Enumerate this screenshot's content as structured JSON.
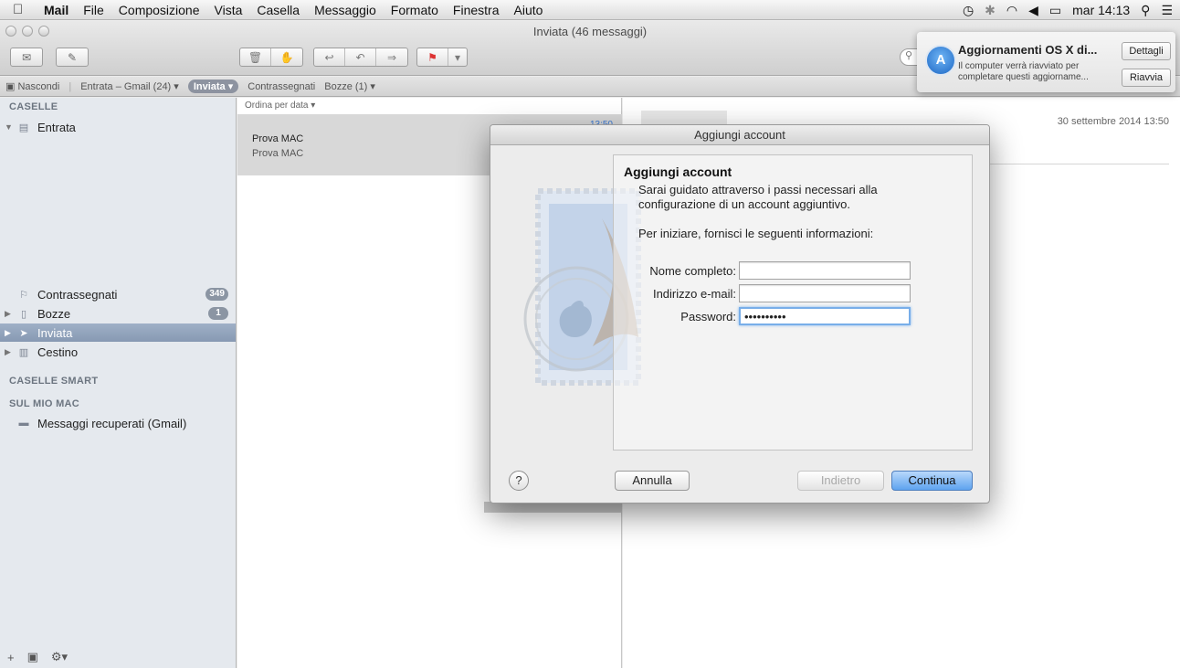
{
  "menubar": {
    "app_name": "Mail",
    "items": [
      "File",
      "Composizione",
      "Vista",
      "Casella",
      "Messaggio",
      "Formato",
      "Finestra",
      "Aiuto"
    ],
    "clock": "mar 14:13"
  },
  "window": {
    "title": "Inviata (46 messaggi)"
  },
  "favorites": {
    "hide": "Nascondi",
    "inbox": "Entrata – Gmail (24) ▾",
    "sent": "Inviata ▾",
    "flagged": "Contrassegnati",
    "drafts": "Bozze (1) ▾"
  },
  "sidebar": {
    "mailboxes_header": "CASELLE",
    "inbox": "Entrata",
    "flagged": "Contrassegnati",
    "flagged_count": "349",
    "drafts": "Bozze",
    "drafts_count": "1",
    "sent": "Inviata",
    "trash": "Cestino",
    "smart_header": "CASELLE SMART",
    "onmac_header": "SUL MIO MAC",
    "recovered": "Messaggi recuperati (Gmail)"
  },
  "list": {
    "sort": "Ordina per data ▾",
    "messages": [
      {
        "from": "Prova MAC",
        "subject": "Prova MAC",
        "time": "13:50"
      }
    ]
  },
  "preview": {
    "date": "30 settembre 2014 13:50"
  },
  "notification": {
    "title": "Aggiornamenti OS X di...",
    "body": "Il computer verrà riavviato per completare questi aggiorname...",
    "details": "Dettagli",
    "restart": "Riavvia"
  },
  "dialog": {
    "title": "Aggiungi account",
    "heading": "Aggiungi account",
    "intro": "Sarai guidato attraverso i passi necessari alla configurazione di un account aggiuntivo.",
    "prompt": "Per iniziare, fornisci le seguenti informazioni:",
    "name_label": "Nome completo:",
    "name_value": "",
    "email_label": "Indirizzo e-mail:",
    "email_value": "",
    "password_label": "Password:",
    "password_value": "••••••••••",
    "help": "?",
    "cancel": "Annulla",
    "back": "Indietro",
    "continue": "Continua"
  },
  "colors": {
    "selection": "#8799b3",
    "primary_button": "#5ea3ef",
    "time_accent": "#3a79d6"
  }
}
